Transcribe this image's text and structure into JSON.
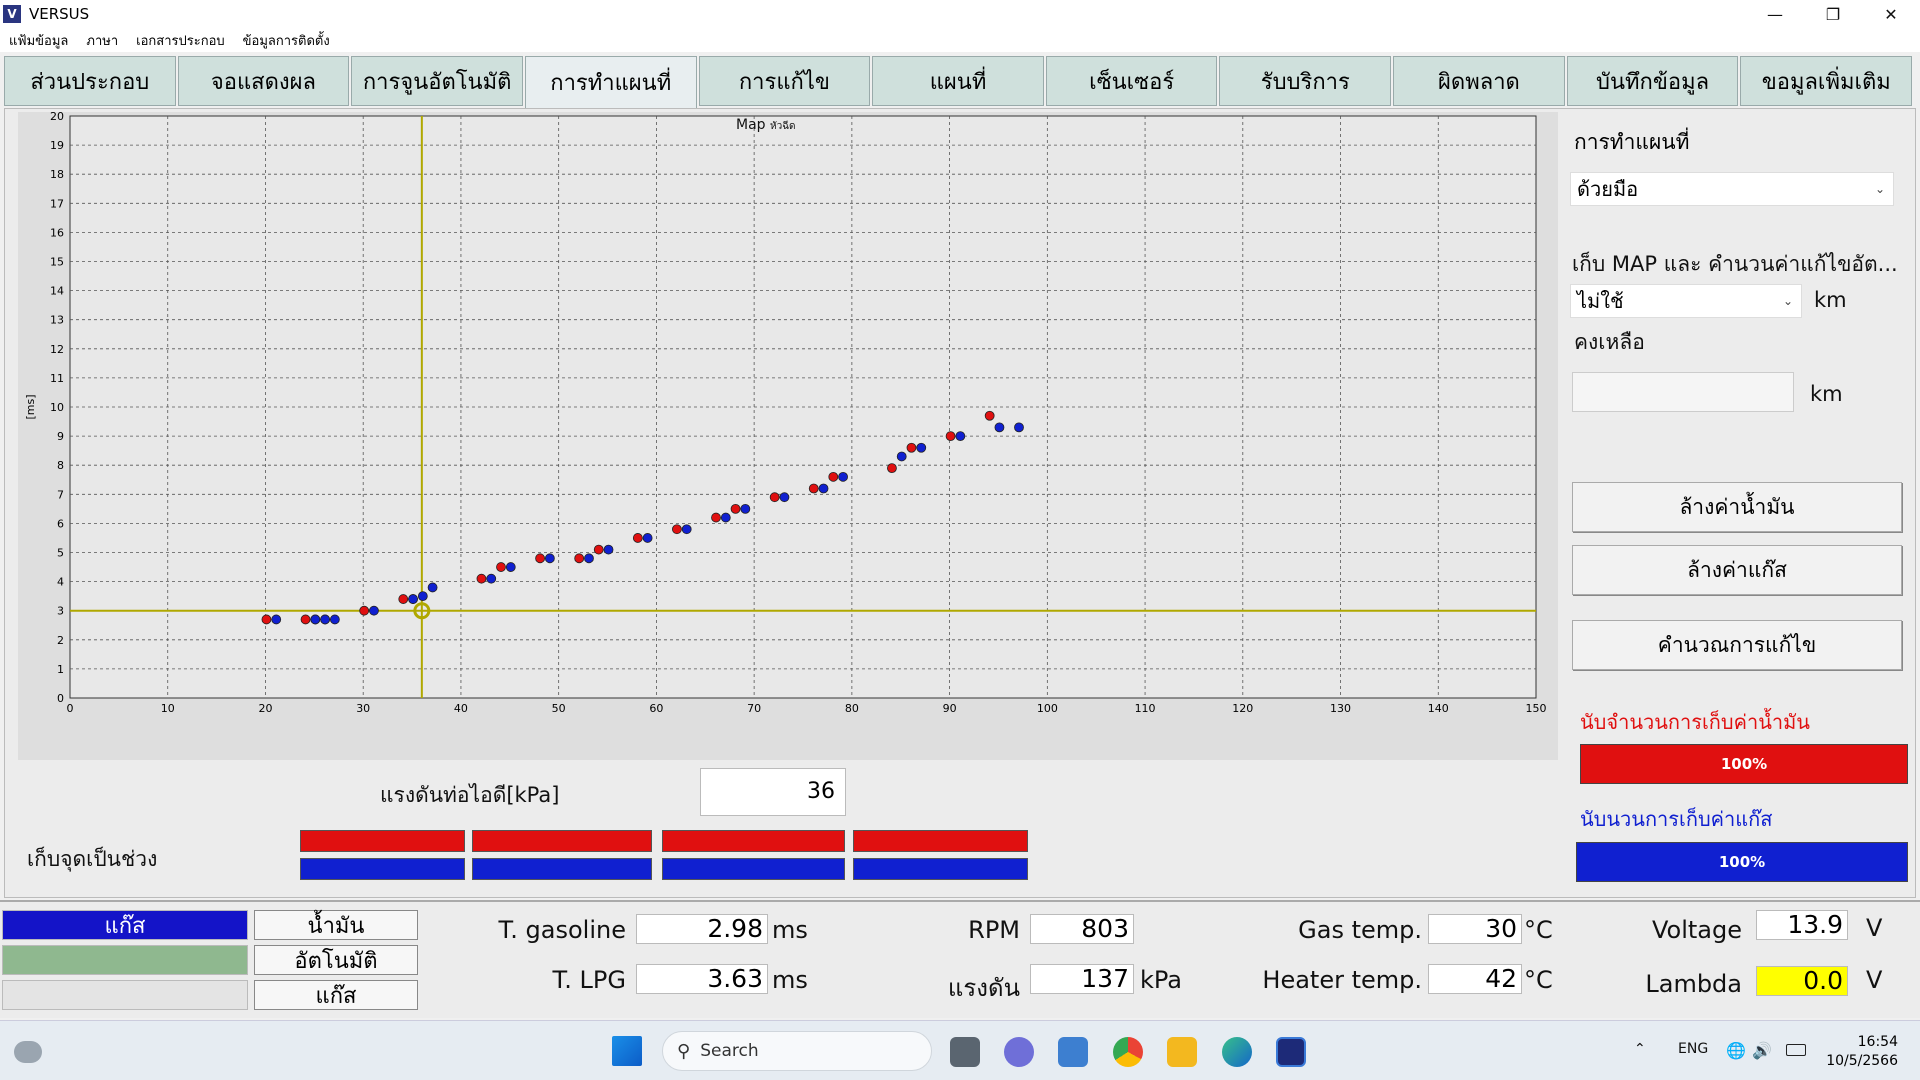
{
  "window": {
    "title": "VERSUS",
    "icon_letter": "V",
    "minimize": "—",
    "maximize": "❐",
    "close": "✕"
  },
  "menu": [
    "แฟ้มข้อมูล",
    "ภาษา",
    "เอกสารประกอบ",
    "ข้อมูลการติดตั้ง"
  ],
  "tabs": [
    "ส่วนประกอบ",
    "จอแสดงผล",
    "การจูนอัตโนมัติ",
    "การทำแผนที่",
    "การแก้ไข",
    "แผนที่",
    "เซ็นเซอร์",
    "รับบริการ",
    "ผิดพลาด",
    "บันทึกข้อมูล",
    "ขอมูลเพิ่มเติม"
  ],
  "active_tab": 3,
  "chart_data": {
    "type": "scatter",
    "title": "Map",
    "title_small": "หัวฉีด",
    "ylabel": "[ms]",
    "xlabel": "",
    "xlim": [
      0,
      150
    ],
    "ylim": [
      0,
      20
    ],
    "x_ticks": [
      0,
      10,
      20,
      30,
      40,
      50,
      60,
      70,
      80,
      90,
      100,
      110,
      120,
      130,
      140,
      150
    ],
    "y_ticks": [
      0,
      1,
      2,
      3,
      4,
      5,
      6,
      7,
      8,
      9,
      10,
      11,
      12,
      13,
      14,
      15,
      16,
      17,
      18,
      19,
      20
    ],
    "grid": true,
    "cursor": {
      "x": 36,
      "y": 3.0
    },
    "series": [
      {
        "color": "#e01010",
        "points": [
          [
            20.1,
            2.7
          ],
          [
            24.1,
            2.7
          ],
          [
            25.1,
            2.7
          ],
          [
            26.1,
            2.7
          ],
          [
            30.1,
            3.0
          ],
          [
            34.1,
            3.4
          ],
          [
            35.1,
            3.4
          ],
          [
            42.1,
            4.1
          ],
          [
            44.1,
            4.5
          ],
          [
            48.1,
            4.8
          ],
          [
            52.1,
            4.8
          ],
          [
            54.1,
            5.1
          ],
          [
            58.1,
            5.5
          ],
          [
            62.1,
            5.8
          ],
          [
            66.1,
            6.2
          ],
          [
            68.1,
            6.5
          ],
          [
            72.1,
            6.9
          ],
          [
            76.1,
            7.2
          ],
          [
            78.1,
            7.6
          ],
          [
            84.1,
            7.9
          ],
          [
            86.1,
            8.6
          ],
          [
            90.1,
            9.0
          ],
          [
            94.1,
            9.7
          ]
        ]
      },
      {
        "color": "#1020d0",
        "points": [
          [
            21.1,
            2.7
          ],
          [
            25.1,
            2.7
          ],
          [
            26.1,
            2.7
          ],
          [
            27.1,
            2.7
          ],
          [
            31.1,
            3.0
          ],
          [
            35.1,
            3.4
          ],
          [
            36.1,
            3.5
          ],
          [
            37.1,
            3.8
          ],
          [
            43.1,
            4.1
          ],
          [
            45.1,
            4.5
          ],
          [
            49.1,
            4.8
          ],
          [
            53.1,
            4.8
          ],
          [
            55.1,
            5.1
          ],
          [
            59.1,
            5.5
          ],
          [
            63.1,
            5.8
          ],
          [
            67.1,
            6.2
          ],
          [
            69.1,
            6.5
          ],
          [
            73.1,
            6.9
          ],
          [
            77.1,
            7.2
          ],
          [
            79.1,
            7.6
          ],
          [
            85.1,
            8.3
          ],
          [
            87.1,
            8.6
          ],
          [
            91.1,
            9.0
          ],
          [
            95.1,
            9.3
          ],
          [
            97.1,
            9.3
          ]
        ]
      }
    ]
  },
  "pressure": {
    "label": "แรงดันท่อไอดี[kPa]",
    "value": "36"
  },
  "range_label": "เก็บจุดเป็นช่วง",
  "right": {
    "title": "การทำแผนที่",
    "mode_select": "ด้วยมือ",
    "collect_label": "เก็บ MAP และ คำนวนค่าแก้ไขอัต...",
    "collect_select": "ไม่ใช้",
    "km_unit": "km",
    "remaining_label": "คงเหลือ",
    "remaining_value": "",
    "btn_clear_oil": "ล้างค่าน้ำมัน",
    "btn_clear_gas": "ล้างค่าแก๊ส",
    "btn_calc": "คำนวณการแก้ไข",
    "count_oil_label": "นับจำนวนการเก็บค่าน้ำมัน",
    "count_oil_value": "100%",
    "count_gas_label": "นับนวนการเก็บค่าแก๊ส",
    "count_gas_value": "100%",
    "colors": {
      "oil": "#e01010",
      "gas": "#1020d0"
    }
  },
  "status": {
    "mode_gas": "แก๊ส",
    "btn_oil": "น้ำมัน",
    "btn_auto": "อัตโนมัติ",
    "btn_gas": "แก๊ส",
    "t_gasoline_label": "T. gasoline",
    "t_gasoline": "2.98",
    "ms": "ms",
    "t_lpg_label": "T. LPG",
    "t_lpg": "3.63",
    "rpm_label": "RPM",
    "rpm": "803",
    "pressure_label": "แรงดัน",
    "pressure": "137",
    "kpa": "kPa",
    "gas_temp_label": "Gas temp.",
    "gas_temp": "30",
    "degc": "°C",
    "heater_temp_label": "Heater temp.",
    "heater_temp": "42",
    "voltage_label": "Voltage",
    "voltage": "13.9",
    "v": "V",
    "lambda_label": "Lambda",
    "lambda": "0.0"
  },
  "taskbar": {
    "search": "Search",
    "lang": "ENG",
    "time": "16:54",
    "date": "10/5/2566"
  }
}
